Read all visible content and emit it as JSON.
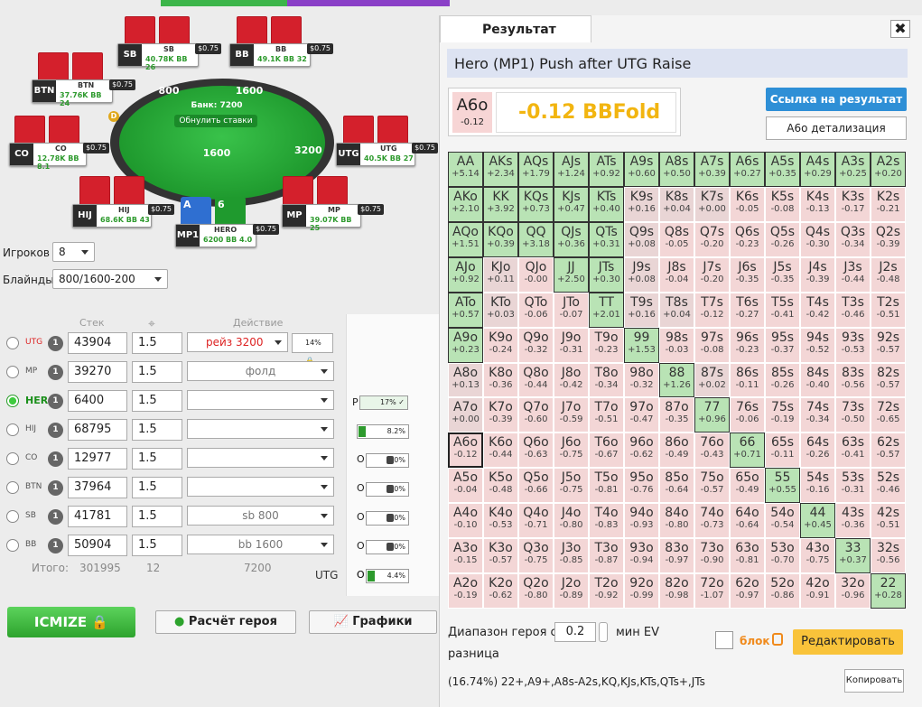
{
  "table": {
    "pot_label": "Банк: 7200",
    "reset_label": "Обнулить ставки",
    "watermark": "ICMIZER",
    "center_chips": "1600",
    "top_chips_left": "800",
    "top_chips_right": "1600",
    "right_chips": "3200",
    "seats": [
      {
        "pos": "SB",
        "name": "SB",
        "tag": "$0.75",
        "stack": "40.78K",
        "bb": "26"
      },
      {
        "pos": "BB",
        "name": "BB",
        "tag": "$0.75",
        "stack": "49.1K",
        "bb": "32"
      },
      {
        "pos": "BTN",
        "name": "BTN",
        "tag": "$0.75",
        "stack": "37.76K",
        "bb": "24"
      },
      {
        "pos": "CO",
        "name": "CO",
        "tag": "$0.75",
        "stack": "12.78K",
        "bb": "8.1"
      },
      {
        "pos": "UTG",
        "name": "UTG",
        "tag": "$0.75",
        "stack": "40.5K",
        "bb": "27"
      },
      {
        "pos": "HIJ",
        "name": "HIJ",
        "tag": "$0.75",
        "stack": "68.6K",
        "bb": "43"
      },
      {
        "pos": "MP",
        "name": "MP",
        "tag": "$0.75",
        "stack": "39.07K",
        "bb": "25"
      },
      {
        "pos": "MP1",
        "name": "HERO",
        "tag": "$0.75",
        "stack": "6200",
        "bb": "4.0"
      }
    ],
    "hero_cards": [
      "A",
      "6"
    ],
    "dealer": "D"
  },
  "settings": {
    "players_label": "Игроков",
    "players_value": "8",
    "blinds_label": "Блайнды",
    "blinds_value": "800/1600-200"
  },
  "columns": {
    "stack": "Стек",
    "action": "Действие"
  },
  "players": [
    {
      "pos": "UTG",
      "count": "1",
      "stack": "43904",
      "bounty": "1.5",
      "action": "рейз 3200",
      "pct": "14%"
    },
    {
      "pos": "MP",
      "count": "1",
      "stack": "39270",
      "bounty": "1.5",
      "action": "фолд"
    },
    {
      "pos": "HERO",
      "count": "1",
      "stack": "6400",
      "bounty": "1.5",
      "action": ""
    },
    {
      "pos": "HIJ",
      "count": "1",
      "stack": "68795",
      "bounty": "1.5",
      "action": ""
    },
    {
      "pos": "CO",
      "count": "1",
      "stack": "12977",
      "bounty": "1.5",
      "action": ""
    },
    {
      "pos": "BTN",
      "count": "1",
      "stack": "37964",
      "bounty": "1.5",
      "action": ""
    },
    {
      "pos": "SB",
      "count": "1",
      "stack": "41781",
      "bounty": "1.5",
      "action": "sb 800"
    },
    {
      "pos": "BB",
      "count": "1",
      "stack": "50904",
      "bounty": "1.5",
      "action": "bb 1600"
    }
  ],
  "footer": {
    "label": "Итого:",
    "total": "301995",
    "count": "12",
    "action_total": "7200",
    "pos": "UTG"
  },
  "mid": {
    "p_label": "P",
    "p_pct": "17%",
    "first": "8.2%",
    "o_label": "O",
    "rows": [
      "0%",
      "0%",
      "0%",
      "0%",
      "0%"
    ],
    "last": "4.4%"
  },
  "buttons": {
    "icmize": "ICMIZE",
    "hero_calc": "Расчёт героя",
    "charts": "Графики"
  },
  "result": {
    "tab": "Результат",
    "close": "✖",
    "title": "Hero (MP1) Push after UTG Raise",
    "hand": "A6o",
    "hand_ev": "-0.12",
    "ev_text": "-0.12 BBFold",
    "link_btn": "Ссылка на результат",
    "detail_btn": "A6o детализация",
    "range_label": "Диапазон героя с",
    "range_value": "0.2",
    "ev_label": "мин EV",
    "diff_label": "разница",
    "block_label": "блок",
    "edit_btn": "Редактировать",
    "range_text": "(16.74%) 22+,A9+,A8s-A2s,KQ,KJs,KTs,QTs+,JTs",
    "copy_btn": "Копировать"
  },
  "grid": [
    [
      [
        "AA",
        "+5.14"
      ],
      [
        "AKs",
        "+2.34"
      ],
      [
        "AQs",
        "+1.79"
      ],
      [
        "AJs",
        "+1.24"
      ],
      [
        "ATs",
        "+0.92"
      ],
      [
        "A9s",
        "+0.60"
      ],
      [
        "A8s",
        "+0.50"
      ],
      [
        "A7s",
        "+0.39"
      ],
      [
        "A6s",
        "+0.27"
      ],
      [
        "A5s",
        "+0.35"
      ],
      [
        "A4s",
        "+0.29"
      ],
      [
        "A3s",
        "+0.25"
      ],
      [
        "A2s",
        "+0.20"
      ]
    ],
    [
      [
        "AKo",
        "+2.10"
      ],
      [
        "KK",
        "+3.92"
      ],
      [
        "KQs",
        "+0.73"
      ],
      [
        "KJs",
        "+0.47"
      ],
      [
        "KTs",
        "+0.40"
      ],
      [
        "K9s",
        "+0.16"
      ],
      [
        "K8s",
        "+0.04"
      ],
      [
        "K7s",
        "+0.00"
      ],
      [
        "K6s",
        "-0.05"
      ],
      [
        "K5s",
        "-0.08"
      ],
      [
        "K4s",
        "-0.13"
      ],
      [
        "K3s",
        "-0.17"
      ],
      [
        "K2s",
        "-0.21"
      ]
    ],
    [
      [
        "AQo",
        "+1.51"
      ],
      [
        "KQo",
        "+0.39"
      ],
      [
        "QQ",
        "+3.18"
      ],
      [
        "QJs",
        "+0.36"
      ],
      [
        "QTs",
        "+0.31"
      ],
      [
        "Q9s",
        "+0.08"
      ],
      [
        "Q8s",
        "-0.05"
      ],
      [
        "Q7s",
        "-0.20"
      ],
      [
        "Q6s",
        "-0.23"
      ],
      [
        "Q5s",
        "-0.26"
      ],
      [
        "Q4s",
        "-0.30"
      ],
      [
        "Q3s",
        "-0.34"
      ],
      [
        "Q2s",
        "-0.39"
      ]
    ],
    [
      [
        "AJo",
        "+0.92"
      ],
      [
        "KJo",
        "+0.11"
      ],
      [
        "QJo",
        "-0.00"
      ],
      [
        "JJ",
        "+2.50"
      ],
      [
        "JTs",
        "+0.30"
      ],
      [
        "J9s",
        "+0.08"
      ],
      [
        "J8s",
        "-0.04"
      ],
      [
        "J7s",
        "-0.20"
      ],
      [
        "J6s",
        "-0.35"
      ],
      [
        "J5s",
        "-0.35"
      ],
      [
        "J4s",
        "-0.39"
      ],
      [
        "J3s",
        "-0.44"
      ],
      [
        "J2s",
        "-0.48"
      ]
    ],
    [
      [
        "ATo",
        "+0.57"
      ],
      [
        "KTo",
        "+0.03"
      ],
      [
        "QTo",
        "-0.06"
      ],
      [
        "JTo",
        "-0.07"
      ],
      [
        "TT",
        "+2.01"
      ],
      [
        "T9s",
        "+0.16"
      ],
      [
        "T8s",
        "+0.04"
      ],
      [
        "T7s",
        "-0.12"
      ],
      [
        "T6s",
        "-0.27"
      ],
      [
        "T5s",
        "-0.41"
      ],
      [
        "T4s",
        "-0.42"
      ],
      [
        "T3s",
        "-0.46"
      ],
      [
        "T2s",
        "-0.51"
      ]
    ],
    [
      [
        "A9o",
        "+0.23"
      ],
      [
        "K9o",
        "-0.24"
      ],
      [
        "Q9o",
        "-0.32"
      ],
      [
        "J9o",
        "-0.31"
      ],
      [
        "T9o",
        "-0.23"
      ],
      [
        "99",
        "+1.53"
      ],
      [
        "98s",
        "-0.03"
      ],
      [
        "97s",
        "-0.08"
      ],
      [
        "96s",
        "-0.23"
      ],
      [
        "95s",
        "-0.37"
      ],
      [
        "94s",
        "-0.52"
      ],
      [
        "93s",
        "-0.53"
      ],
      [
        "92s",
        "-0.57"
      ]
    ],
    [
      [
        "A8o",
        "+0.13"
      ],
      [
        "K8o",
        "-0.36"
      ],
      [
        "Q8o",
        "-0.44"
      ],
      [
        "J8o",
        "-0.42"
      ],
      [
        "T8o",
        "-0.34"
      ],
      [
        "98o",
        "-0.32"
      ],
      [
        "88",
        "+1.26"
      ],
      [
        "87s",
        "+0.02"
      ],
      [
        "86s",
        "-0.11"
      ],
      [
        "85s",
        "-0.26"
      ],
      [
        "84s",
        "-0.40"
      ],
      [
        "83s",
        "-0.56"
      ],
      [
        "82s",
        "-0.57"
      ]
    ],
    [
      [
        "A7o",
        "+0.00"
      ],
      [
        "K7o",
        "-0.39"
      ],
      [
        "Q7o",
        "-0.60"
      ],
      [
        "J7o",
        "-0.59"
      ],
      [
        "T7o",
        "-0.51"
      ],
      [
        "97o",
        "-0.47"
      ],
      [
        "87o",
        "-0.35"
      ],
      [
        "77",
        "+0.96"
      ],
      [
        "76s",
        "-0.06"
      ],
      [
        "75s",
        "-0.19"
      ],
      [
        "74s",
        "-0.34"
      ],
      [
        "73s",
        "-0.50"
      ],
      [
        "72s",
        "-0.65"
      ]
    ],
    [
      [
        "A6o",
        "-0.12"
      ],
      [
        "K6o",
        "-0.44"
      ],
      [
        "Q6o",
        "-0.63"
      ],
      [
        "J6o",
        "-0.75"
      ],
      [
        "T6o",
        "-0.67"
      ],
      [
        "96o",
        "-0.62"
      ],
      [
        "86o",
        "-0.49"
      ],
      [
        "76o",
        "-0.43"
      ],
      [
        "66",
        "+0.71"
      ],
      [
        "65s",
        "-0.11"
      ],
      [
        "64s",
        "-0.26"
      ],
      [
        "63s",
        "-0.41"
      ],
      [
        "62s",
        "-0.57"
      ]
    ],
    [
      [
        "A5o",
        "-0.04"
      ],
      [
        "K5o",
        "-0.48"
      ],
      [
        "Q5o",
        "-0.66"
      ],
      [
        "J5o",
        "-0.75"
      ],
      [
        "T5o",
        "-0.81"
      ],
      [
        "95o",
        "-0.76"
      ],
      [
        "85o",
        "-0.64"
      ],
      [
        "75o",
        "-0.57"
      ],
      [
        "65o",
        "-0.49"
      ],
      [
        "55",
        "+0.55"
      ],
      [
        "54s",
        "-0.16"
      ],
      [
        "53s",
        "-0.31"
      ],
      [
        "52s",
        "-0.46"
      ]
    ],
    [
      [
        "A4o",
        "-0.10"
      ],
      [
        "K4o",
        "-0.53"
      ],
      [
        "Q4o",
        "-0.71"
      ],
      [
        "J4o",
        "-0.80"
      ],
      [
        "T4o",
        "-0.83"
      ],
      [
        "94o",
        "-0.93"
      ],
      [
        "84o",
        "-0.80"
      ],
      [
        "74o",
        "-0.73"
      ],
      [
        "64o",
        "-0.64"
      ],
      [
        "54o",
        "-0.54"
      ],
      [
        "44",
        "+0.45"
      ],
      [
        "43s",
        "-0.36"
      ],
      [
        "42s",
        "-0.51"
      ]
    ],
    [
      [
        "A3o",
        "-0.15"
      ],
      [
        "K3o",
        "-0.57"
      ],
      [
        "Q3o",
        "-0.75"
      ],
      [
        "J3o",
        "-0.85"
      ],
      [
        "T3o",
        "-0.87"
      ],
      [
        "93o",
        "-0.94"
      ],
      [
        "83o",
        "-0.97"
      ],
      [
        "73o",
        "-0.90"
      ],
      [
        "63o",
        "-0.81"
      ],
      [
        "53o",
        "-0.70"
      ],
      [
        "43o",
        "-0.75"
      ],
      [
        "33",
        "+0.37"
      ],
      [
        "32s",
        "-0.56"
      ]
    ],
    [
      [
        "A2o",
        "-0.19"
      ],
      [
        "K2o",
        "-0.62"
      ],
      [
        "Q2o",
        "-0.80"
      ],
      [
        "J2o",
        "-0.89"
      ],
      [
        "T2o",
        "-0.92"
      ],
      [
        "92o",
        "-0.99"
      ],
      [
        "82o",
        "-0.98"
      ],
      [
        "72o",
        "-1.07"
      ],
      [
        "62o",
        "-0.97"
      ],
      [
        "52o",
        "-0.86"
      ],
      [
        "42o",
        "-0.91"
      ],
      [
        "32o",
        "-0.96"
      ],
      [
        "22",
        "+0.28"
      ]
    ]
  ],
  "highlight": [
    "AA",
    "AKs",
    "AQs",
    "AJs",
    "ATs",
    "A9s",
    "A8s",
    "A7s",
    "A6s",
    "A5s",
    "A4s",
    "A3s",
    "A2s",
    "AKo",
    "KK",
    "KQs",
    "KJs",
    "KTs",
    "AQo",
    "KQo",
    "QQ",
    "QJs",
    "QTs",
    "AJo",
    "JJ",
    "JTs",
    "ATo",
    "TT",
    "A9o",
    "99",
    "88",
    "77",
    "66",
    "55",
    "44",
    "33",
    "22"
  ],
  "current": "A6o"
}
